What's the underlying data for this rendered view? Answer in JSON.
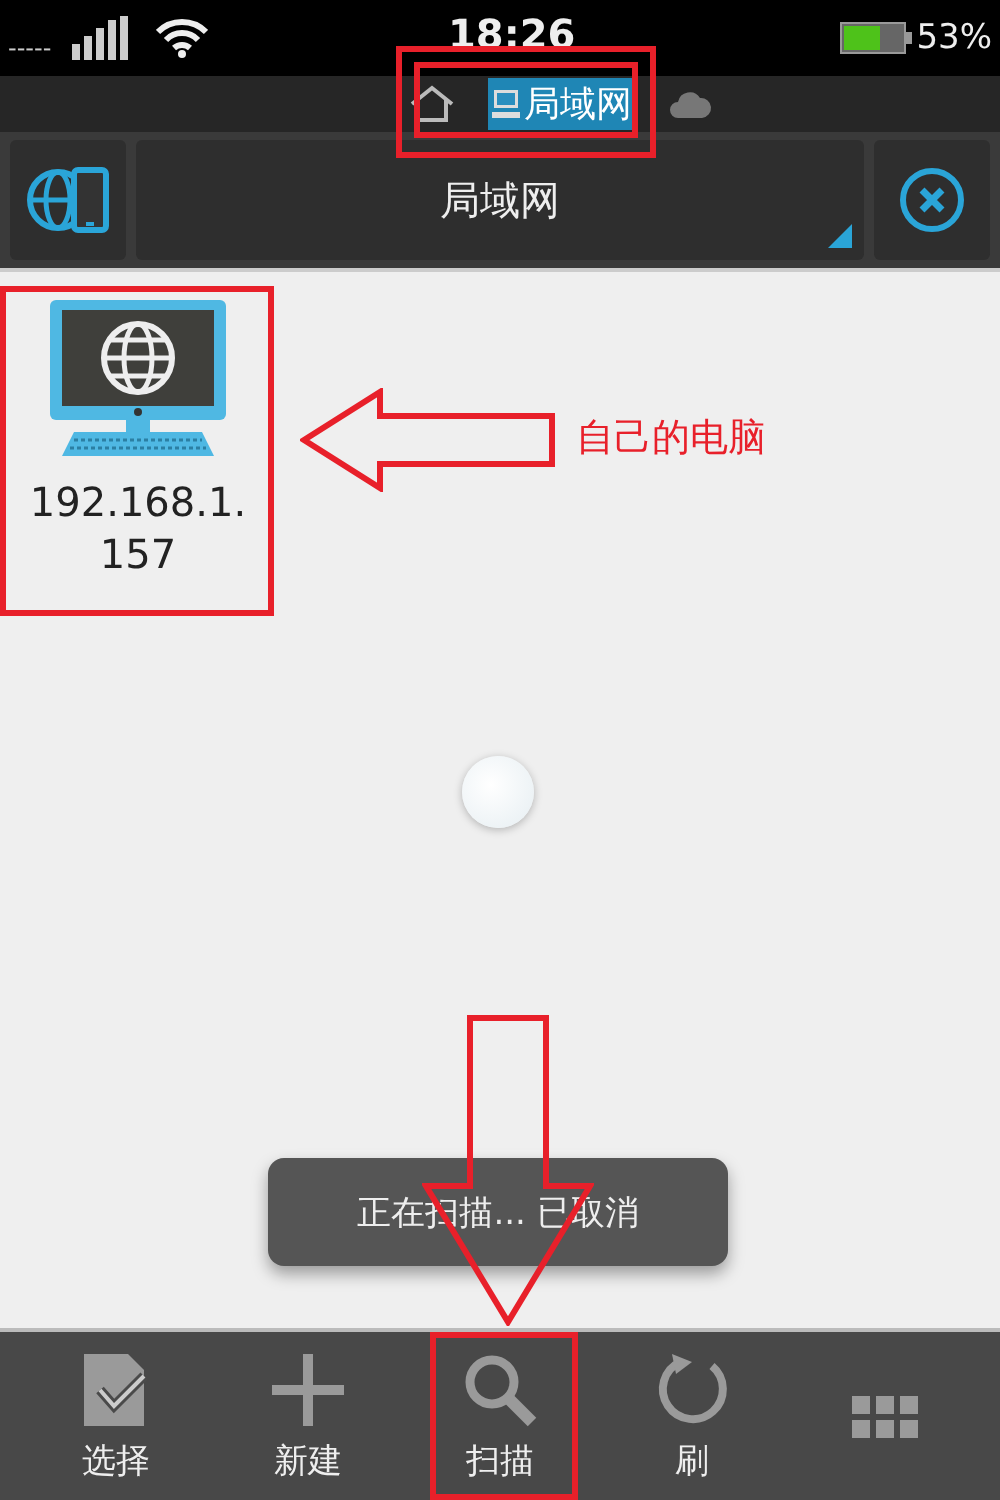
{
  "status_bar": {
    "carrier": "-----",
    "time": "18:26",
    "battery": "53%"
  },
  "breadcrumb": [
    {
      "kind": "home",
      "selected": false
    },
    {
      "kind": "lan",
      "label": "局域网",
      "selected": true
    },
    {
      "kind": "cloud",
      "selected": false
    }
  ],
  "toolbar": {
    "path": "局域网"
  },
  "items": [
    {
      "name": "192.168.1.157"
    }
  ],
  "toast": "正在扫描... 已取消",
  "bottom_bar": [
    {
      "kind": "select",
      "label": "选择"
    },
    {
      "kind": "new",
      "label": "新建"
    },
    {
      "kind": "scan",
      "label": "扫描"
    },
    {
      "kind": "refresh",
      "label": "刷"
    },
    {
      "kind": "view"
    }
  ],
  "annotation": {
    "note": "自己的电脑"
  }
}
